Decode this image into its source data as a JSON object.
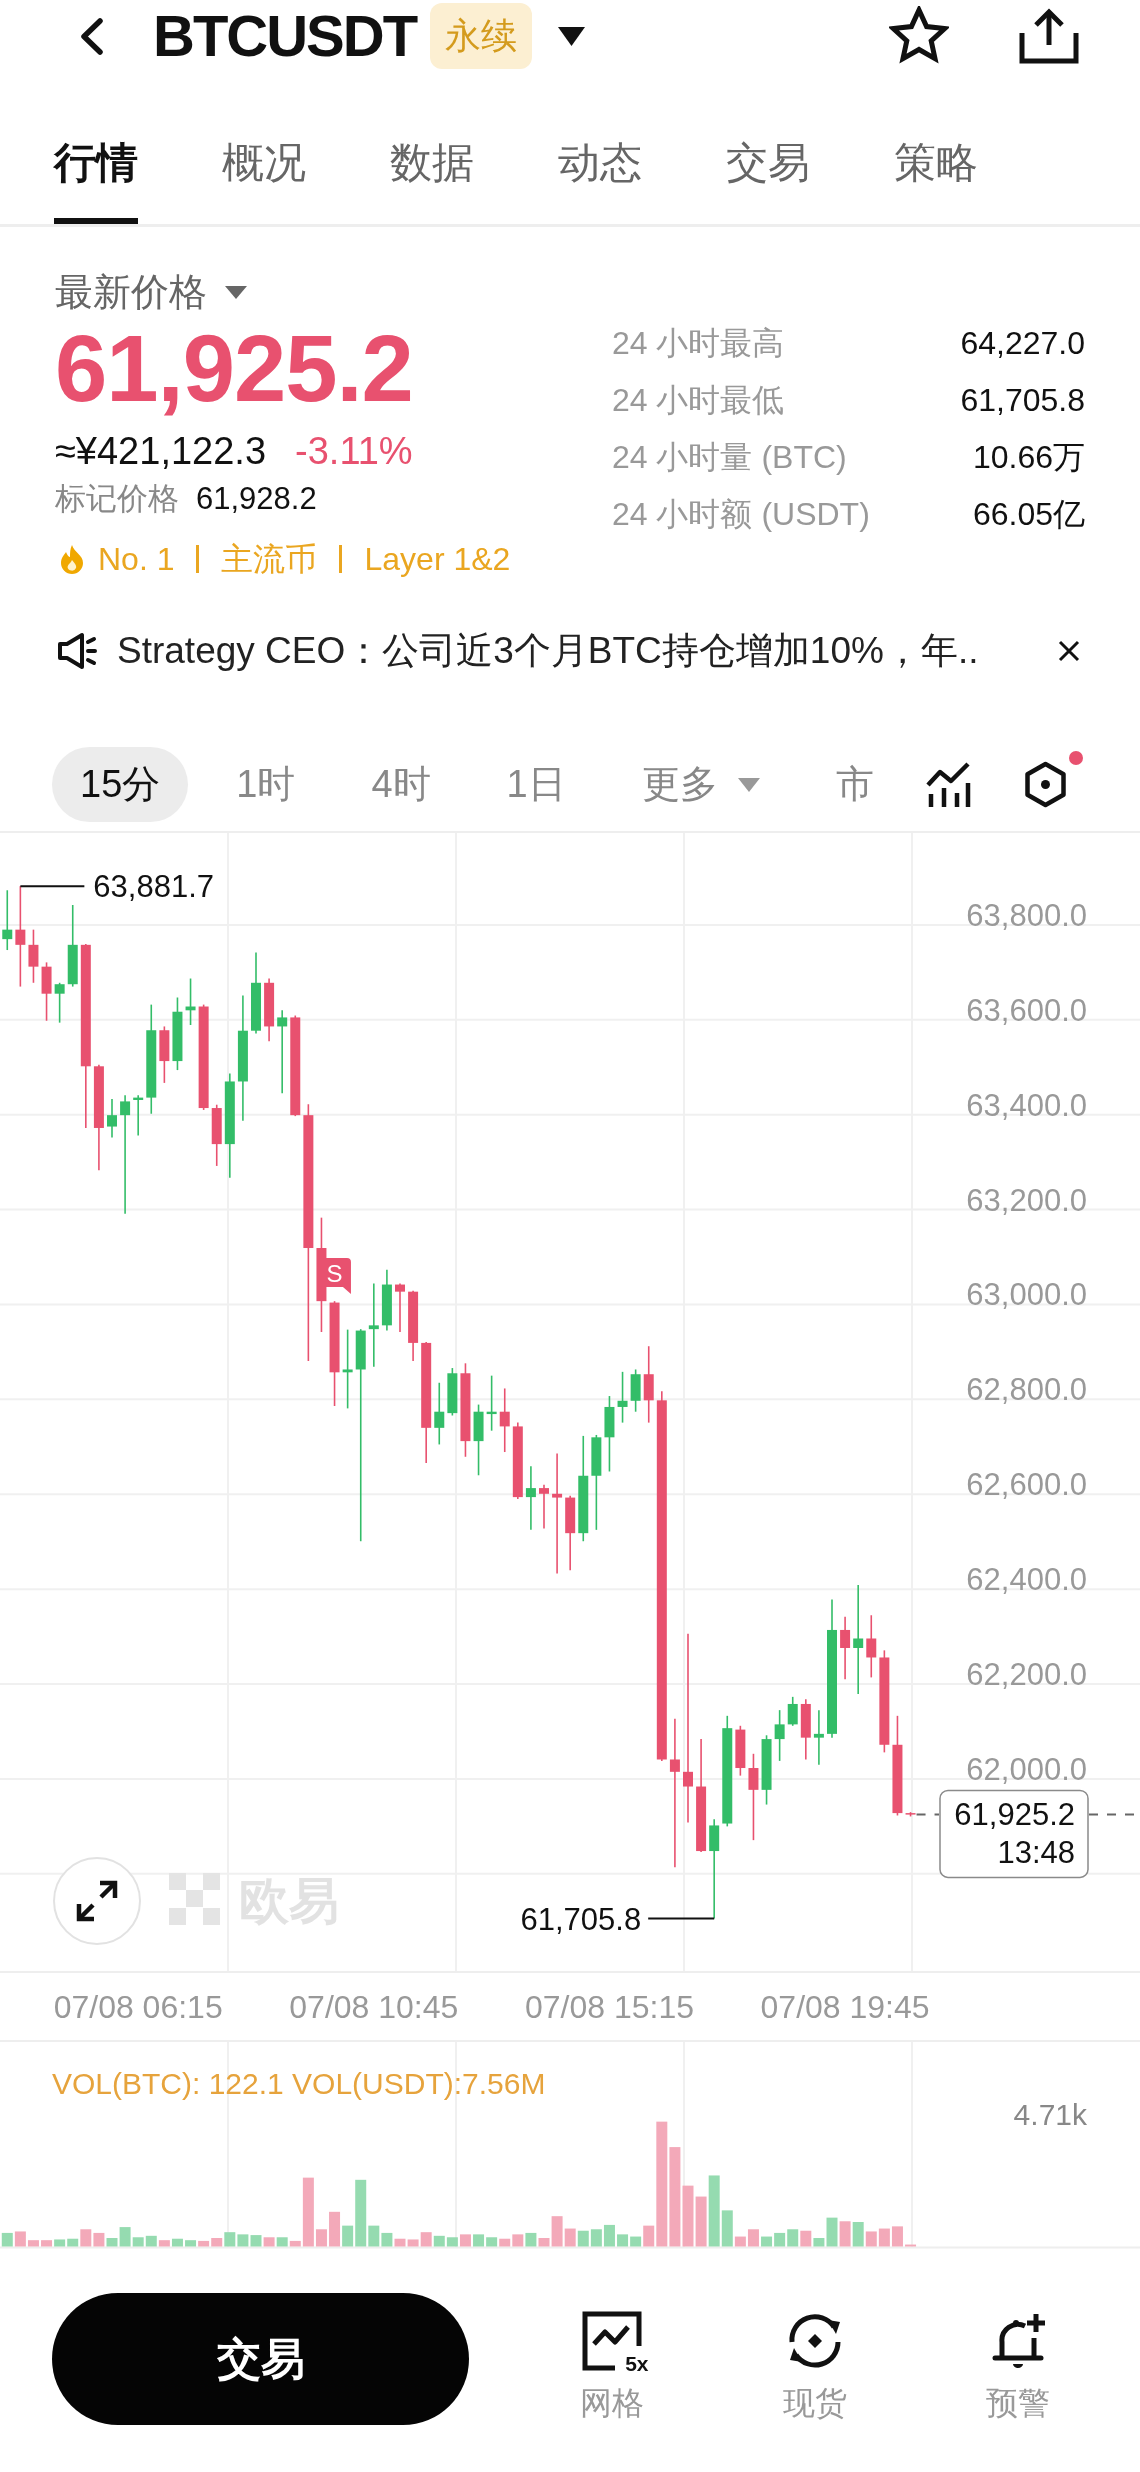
{
  "header": {
    "title": "BTCUSDT",
    "badge": "永续"
  },
  "tabs": [
    {
      "label": "行情",
      "selected": true
    },
    {
      "label": "概况",
      "selected": false
    },
    {
      "label": "数据",
      "selected": false
    },
    {
      "label": "动态",
      "selected": false
    },
    {
      "label": "交易",
      "selected": false
    },
    {
      "label": "策略",
      "selected": false
    }
  ],
  "price": {
    "label": "最新价格",
    "last": "61,925.2",
    "falling": true,
    "fiat": "≈¥421,122.3",
    "change": "-3.11%",
    "mark_label": "标记价格",
    "mark_value": "61,928.2",
    "tags": [
      "No. 1",
      "主流币",
      "Layer 1&2"
    ]
  },
  "stats": [
    {
      "label": "24 小时最高",
      "value": "64,227.0"
    },
    {
      "label": "24 小时最低",
      "value": "61,705.8"
    },
    {
      "label": "24 小时量 (BTC)",
      "value": "10.66万"
    },
    {
      "label": "24 小时额 (USDT)",
      "value": "66.05亿"
    }
  ],
  "news": {
    "text": "Strategy CEO：公司近3个月BTC持仓增加10%，年.."
  },
  "intervals": [
    {
      "label": "15分",
      "kind": "interval",
      "selected": true
    },
    {
      "label": "1时",
      "kind": "interval",
      "selected": false
    },
    {
      "label": "4时",
      "kind": "interval",
      "selected": false
    },
    {
      "label": "1日",
      "kind": "interval",
      "selected": false
    },
    {
      "label": "更多",
      "kind": "menu",
      "selected": false
    },
    {
      "label": "市",
      "kind": "interval",
      "selected": false
    }
  ],
  "chart_tools": {
    "settings_dot": true
  },
  "chart": {
    "watermark": "欧易",
    "signal_label": "S",
    "high_label": "63,881.7",
    "low_label": "61,705.8",
    "last_price": "61,925.2",
    "countdown": "13:48",
    "chart_data": {
      "type": "candlestick",
      "grid": true,
      "categories": [
        null,
        null,
        null,
        null,
        null,
        null,
        null,
        null,
        null,
        null,
        "07/08 06:15",
        null,
        null,
        null,
        null,
        null,
        null,
        null,
        null,
        null,
        null,
        null,
        null,
        null,
        null,
        null,
        null,
        null,
        "07/08 10:45",
        null,
        null,
        null,
        null,
        null,
        null,
        null,
        null,
        null,
        null,
        null,
        null,
        null,
        null,
        null,
        null,
        null,
        "07/08 15:15",
        null,
        null,
        null,
        null,
        null,
        null,
        null,
        null,
        null,
        null,
        null,
        null,
        null,
        null,
        null,
        null,
        null,
        "07/08 19:45",
        null,
        null,
        null,
        null,
        null
      ],
      "ohlc": [
        [
          63770,
          63873,
          63747,
          63790
        ],
        [
          63790,
          63881.7,
          63670,
          63758
        ],
        [
          63758,
          63790,
          63678,
          63712
        ],
        [
          63712,
          63721,
          63598,
          63655
        ],
        [
          63655,
          63678,
          63594,
          63675
        ],
        [
          63675,
          63842,
          63670,
          63758
        ],
        [
          63758,
          63760,
          63372,
          63502
        ],
        [
          63502,
          63505,
          63283,
          63372
        ],
        [
          63375,
          63433,
          63352,
          63399
        ],
        [
          63399,
          63441,
          63191,
          63428
        ],
        [
          63431,
          63441,
          63356,
          63436
        ],
        [
          63436,
          63632,
          63402,
          63578
        ],
        [
          63578,
          63586,
          63467,
          63513
        ],
        [
          63513,
          63647,
          63494,
          63617
        ],
        [
          63620,
          63687,
          63589,
          63628
        ],
        [
          63628,
          63632,
          63410,
          63414
        ],
        [
          63414,
          63421,
          63292,
          63338
        ],
        [
          63338,
          63487,
          63267,
          63470
        ],
        [
          63470,
          63651,
          63387,
          63577
        ],
        [
          63577,
          63742,
          63571,
          63678
        ],
        [
          63678,
          63687,
          63555,
          63586
        ],
        [
          63586,
          63620,
          63445,
          63605
        ],
        [
          63605,
          63609,
          63397,
          63399
        ],
        [
          63399,
          63422,
          62881,
          63119
        ],
        [
          63119,
          63183,
          62942,
          63007
        ],
        [
          63004,
          63007,
          62786,
          62857
        ],
        [
          62857,
          62947,
          62781,
          62863
        ],
        [
          62863,
          62948,
          62501,
          62945
        ],
        [
          62948,
          63044,
          62869,
          62956
        ],
        [
          62956,
          63073,
          62945,
          63042
        ],
        [
          63042,
          63044,
          62942,
          63027
        ],
        [
          63027,
          63029,
          62881,
          62919
        ],
        [
          62919,
          62921,
          62666,
          62740
        ],
        [
          62740,
          62835,
          62705,
          62774
        ],
        [
          62771,
          62866,
          62766,
          62855
        ],
        [
          62855,
          62876,
          62679,
          62712
        ],
        [
          62712,
          62789,
          62640,
          62774
        ],
        [
          62769,
          62850,
          62734,
          62774
        ],
        [
          62774,
          62823,
          62689,
          62743
        ],
        [
          62743,
          62751,
          62590,
          62594
        ],
        [
          62594,
          62659,
          62525,
          62613
        ],
        [
          62613,
          62620,
          62528,
          62601
        ],
        [
          62601,
          62686,
          62433,
          62593
        ],
        [
          62593,
          62597,
          62440,
          62518
        ],
        [
          62518,
          62723,
          62501,
          62639
        ],
        [
          62639,
          62725,
          62525,
          62720
        ],
        [
          62720,
          62807,
          62648,
          62784
        ],
        [
          62784,
          62858,
          62751,
          62797
        ],
        [
          62797,
          62863,
          62774,
          62853
        ],
        [
          62853,
          62912,
          62751,
          62798
        ],
        [
          62798,
          62817,
          62038,
          62041
        ],
        [
          62041,
          62127,
          61814,
          62015
        ],
        [
          62015,
          62306,
          61908,
          61984
        ],
        [
          61984,
          62084,
          61846,
          61848
        ],
        [
          61848,
          61915,
          61705.8,
          61902
        ],
        [
          61906,
          62133,
          61900,
          62107
        ],
        [
          62104,
          62112,
          62007,
          62023
        ],
        [
          62023,
          62053,
          61871,
          61977
        ],
        [
          61977,
          62092,
          61946,
          62084
        ],
        [
          62084,
          62145,
          62038,
          62115
        ],
        [
          62115,
          62173,
          62112,
          62158
        ],
        [
          62158,
          62168,
          62041,
          62087
        ],
        [
          62087,
          62145,
          62030,
          62095
        ],
        [
          62095,
          62378,
          62087,
          62314
        ],
        [
          62314,
          62342,
          62210,
          62276
        ],
        [
          62276,
          62409,
          62179,
          62296
        ],
        [
          62296,
          62345,
          62214,
          62256
        ],
        [
          62256,
          62271,
          62056,
          62072
        ],
        [
          62072,
          62133,
          61923,
          61928
        ],
        [
          61928,
          61930,
          61921,
          61925.2
        ]
      ],
      "ylim": [
        61595.2,
        63993.7
      ],
      "yticks": [
        {
          "value": 63800,
          "label": "63,800.0"
        },
        {
          "value": 63600,
          "label": "63,600.0"
        },
        {
          "value": 63400,
          "label": "63,400.0"
        },
        {
          "value": 63200,
          "label": "63,200.0"
        },
        {
          "value": 63000,
          "label": "63,000.0"
        },
        {
          "value": 62800,
          "label": "62,800.0"
        },
        {
          "value": 62600,
          "label": "62,600.0"
        },
        {
          "value": 62400,
          "label": "62,400.0"
        },
        {
          "value": 62200,
          "label": "62,200.0"
        },
        {
          "value": 62000,
          "label": "62,000.0"
        }
      ]
    }
  },
  "volume": {
    "legend": "VOL(BTC): 122.1 VOL(USDT):7.56M",
    "max_label": "4.71k"
  },
  "bottom_bar": {
    "trade_button": "交易",
    "actions": [
      {
        "label": "网格",
        "kind": "grid",
        "badge": "5x"
      },
      {
        "label": "现货",
        "kind": "spot"
      },
      {
        "label": "预警",
        "kind": "alert"
      }
    ]
  }
}
